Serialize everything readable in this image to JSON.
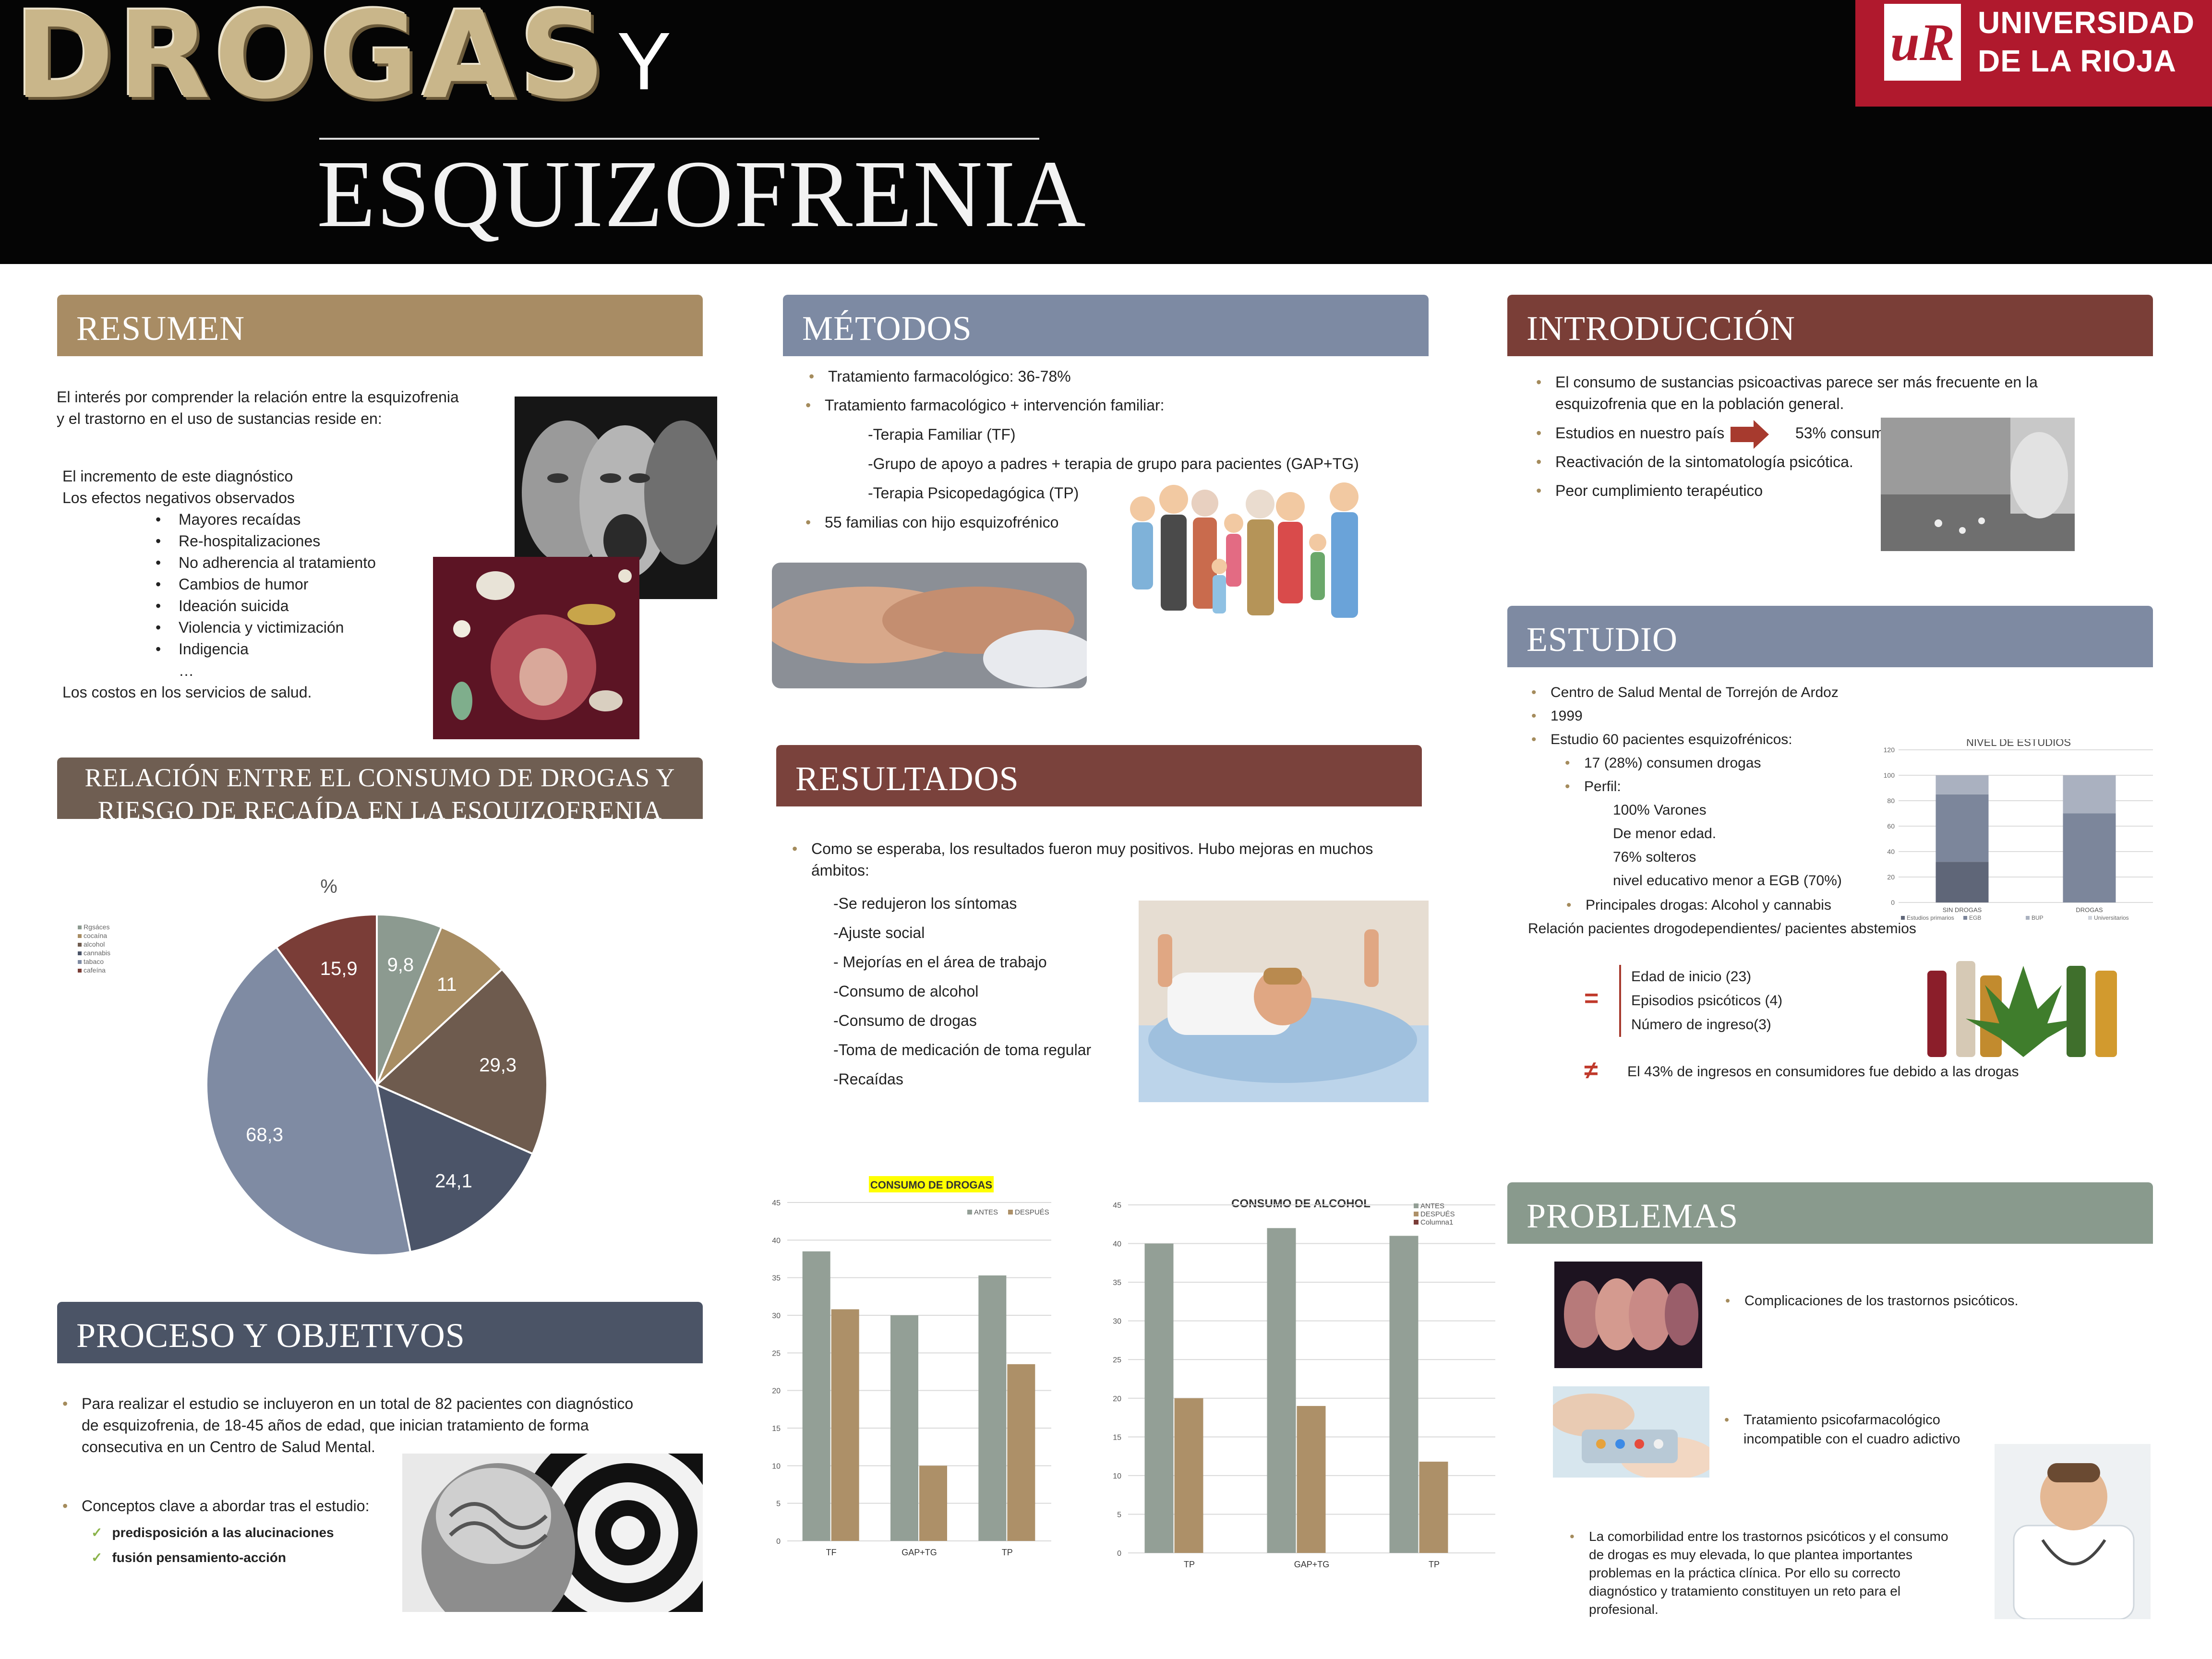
{
  "header": {
    "title_drogas": "DROGAS",
    "title_y": "Y",
    "title_esquizofrenia": "ESQUIZOFRENIA",
    "university_logo_letters": "uR",
    "university_line1": "UNIVERSIDAD",
    "university_line2": "DE LA RIOJA"
  },
  "colors": {
    "resumen": "#a88c64",
    "metodos": "#7d8aa3",
    "introduccion": "#7a3e37",
    "estudio": "#7e8aa2",
    "relacion": "#6f5e52",
    "resultados": "#7a423c",
    "proceso": "#4b5466",
    "problemas": "#899a8d",
    "bullet": "#a48b5c",
    "arrow": "#a73a2e"
  },
  "resumen": {
    "title": "RESUMEN",
    "intro_line1": "El interés por comprender la relación entre la esquizofrenia",
    "intro_line2": "y el trastorno en el uso de sustancias reside en:",
    "line_incremento": "El incremento de este diagnóstico",
    "line_efectos": "Los efectos negativos observados",
    "effects": [
      "Mayores recaídas",
      "Re-hospitalizaciones",
      "No adherencia al tratamiento",
      "Cambios de humor",
      "Ideación  suicida",
      "Violencia y victimización",
      "Indigencia"
    ],
    "ellipsis": "…",
    "line_costos": "Los costos en los servicios de salud."
  },
  "metodos": {
    "title": "MÉTODOS",
    "b1": "Tratamiento farmacológico: 36-78%",
    "b2": "Tratamiento farmacológico + intervención familiar:",
    "sub1": "-Terapia Familiar (TF)",
    "sub2": "-Grupo de apoyo a padres + terapia de grupo para pacientes (GAP+TG)",
    "sub3": "-Terapia Psicopedagógica (TP)",
    "b3": "55 familias con hijo esquizofrénico"
  },
  "introduccion": {
    "title": "INTRODUCCIÓN",
    "b1_line1": "El consumo de sustancias psicoactivas parece ser más frecuente en la",
    "b1_line2": "esquizofrenia  que en la población general.",
    "b2_left": "Estudios en nuestro país",
    "b2_right": "53% consume",
    "b3": "Reactivación de la sintomatología psicótica.",
    "b4": "Peor cumplimiento terapéutico"
  },
  "estudio": {
    "title": "ESTUDIO",
    "b1": "Centro de Salud Mental de Torrejón de Ardoz",
    "b2": "1999",
    "b3": "Estudio 60 pacientes esquizofrénicos:",
    "sb1": "17 (28%) consumen drogas",
    "sb2": "Perfil:",
    "p1": "100% Varones",
    "p2": "De menor edad.",
    "p3": "76% solteros",
    "p4": "nivel educativo menor a EGB (70%)",
    "sb3": "Principales drogas: Alcohol y cannabis",
    "relacion": "Relación pacientes drogodependientes/ pacientes abstemios",
    "equal_sign": "=",
    "notequal_sign": "≠",
    "eq1": "Edad de inicio (23)",
    "eq2": "Episodios psicóticos (4)",
    "eq3": "Número de ingreso(3)",
    "neq": "El 43% de ingresos en consumidores fue debido a las drogas"
  },
  "relacion": {
    "title_line1": "RELACIÓN ENTRE EL CONSUMO DE DROGAS Y",
    "title_line2": "RIESGO DE RECAÍDA EN LA ESQUIZOFRENIA"
  },
  "resultados": {
    "title": "RESULTADOS",
    "b1_line1": "Como se esperaba, los resultados fueron muy positivos.  Hubo mejoras en muchos",
    "b1_line2": "ámbitos:",
    "items": [
      "-Se redujeron los síntomas",
      "-Ajuste social",
      "- Mejorías en el área de trabajo",
      "-Consumo de alcohol",
      "-Consumo de drogas",
      "-Toma de medicación de toma regular",
      "-Recaídas"
    ]
  },
  "proceso": {
    "title": "PROCESO Y OBJETIVOS",
    "b1_line1": "Para realizar el estudio se incluyeron en un total de 82 pacientes con diagnóstico",
    "b1_line2": "de esquizofrenia, de 18-45 años de edad, que inician tratamiento de forma",
    "b1_line3": "consecutiva en un Centro de Salud Mental.",
    "b2": "Conceptos clave a abordar tras el estudio:",
    "check": "✓",
    "c1": "predisposición a las alucinaciones",
    "c2": "fusión pensamiento-acción"
  },
  "problemas": {
    "title": "PROBLEMAS",
    "b1": "Complicaciones de los trastornos psicóticos.",
    "b2_line1": "Tratamiento psicofarmacológico",
    "b2_line2": "incompatible con el cuadro adictivo",
    "b3_line1": "La comorbilidad entre los trastornos psicóticos y el consumo",
    "b3_line2": "de drogas es muy elevada, lo que plantea importantes",
    "b3_line3": "problemas en la práctica clínica. Por ello su correcto",
    "b3_line4": "diagnóstico y tratamiento constituyen un reto para el",
    "b3_line5": "profesional."
  },
  "chart_data": [
    {
      "type": "pie",
      "title": "%",
      "categories": [
        "Ilegibles/Otras",
        "tabaco",
        "cafeína",
        "cannabis",
        "alcohol",
        "cocaína"
      ],
      "legend_labels": [
        "Rgsáces",
        "cocaína",
        "alcohol",
        "cannabis",
        "tabaco",
        "cafeína"
      ],
      "values": [
        9.8,
        11,
        29.3,
        24.1,
        68.3,
        15.9
      ],
      "labels": [
        "9,8",
        "11",
        "29,3",
        "24,1",
        "68,3",
        "15,9"
      ],
      "colors": [
        "#8c9a90",
        "#a88d63",
        "#6e5b4e",
        "#4b5468",
        "#7f8ba3",
        "#7a3d37"
      ],
      "legend_position": "top-left"
    },
    {
      "type": "bar",
      "title": "CONSUMO DE DROGAS",
      "categories": [
        "TF",
        "GAP+TG",
        "TP"
      ],
      "series": [
        {
          "name": "ANTES",
          "values": [
            38.5,
            30,
            35.3
          ],
          "color": "#939f96"
        },
        {
          "name": "DESPUÉS",
          "values": [
            30.8,
            10,
            23.5
          ],
          "color": "#ad9068"
        }
      ],
      "ylim": [
        0,
        45
      ],
      "yticks": [
        "0",
        "5",
        "10",
        "15",
        "20",
        "25",
        "30",
        "35",
        "40",
        "45"
      ],
      "legend_position": "top-right"
    },
    {
      "type": "bar",
      "title": "CONSUMO DE ALCOHOL",
      "categories": [
        "TP",
        "GAP+TG",
        "TP"
      ],
      "series": [
        {
          "name": "ANTES",
          "values": [
            40,
            42,
            41
          ],
          "color": "#939f96"
        },
        {
          "name": "DESPUÉS",
          "values": [
            20,
            19,
            11.8
          ],
          "color": "#ad9068"
        },
        {
          "name": "Columna1",
          "values": [
            0,
            0,
            0
          ],
          "color": "#7a3d37"
        }
      ],
      "ylim": [
        0,
        45
      ],
      "yticks": [
        "0",
        "5",
        "10",
        "15",
        "20",
        "25",
        "30",
        "35",
        "40",
        "45"
      ],
      "legend_position": "top-right"
    },
    {
      "type": "bar",
      "title": "NIVEL DE ESTUDIOS",
      "categories": [
        "SIN DROGAS",
        "DROGAS"
      ],
      "yticks": [
        "0",
        "20",
        "40",
        "60",
        "80",
        "100",
        "120"
      ],
      "ylim": [
        0,
        120
      ],
      "series": [
        {
          "name": "Estudios primarios",
          "values": [
            32,
            0
          ],
          "color": "#5f6678"
        },
        {
          "name": "EGB",
          "values": [
            53,
            70
          ],
          "color": "#7c869b"
        },
        {
          "name": "BUP",
          "values": [
            15,
            30
          ],
          "color": "#aab1c0"
        },
        {
          "name": "Universitarios",
          "values": [
            0,
            0
          ],
          "color": "#d0d4dc"
        }
      ],
      "legend_labels": [
        "Estudios primarios",
        "EGB",
        "BUP",
        "Universitarios"
      ],
      "legend_position": "bottom"
    }
  ]
}
